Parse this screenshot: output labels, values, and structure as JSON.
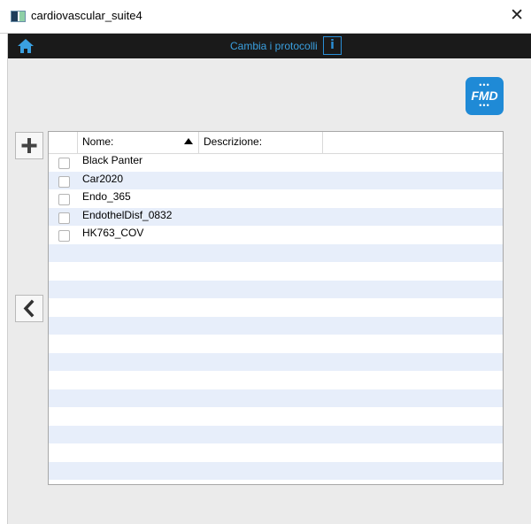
{
  "window": {
    "title": "cardiovascular_suite4",
    "close_glyph": "✕"
  },
  "appbar": {
    "protocols_label": "Cambia i protocolli",
    "info_glyph": "i"
  },
  "logo": {
    "text": "FMD",
    "color": "#1f8ad6"
  },
  "table": {
    "columns": {
      "name": "Nome:",
      "description": "Descrizione:"
    },
    "sort": {
      "column": "name",
      "direction": "ascending"
    },
    "rows": [
      {
        "name": "Black Panter",
        "description": ""
      },
      {
        "name": "Car2020",
        "description": ""
      },
      {
        "name": "Endo_365",
        "description": ""
      },
      {
        "name": "EndothelDisf_0832",
        "description": ""
      },
      {
        "name": "HK763_COV",
        "description": ""
      }
    ]
  },
  "colors": {
    "accent": "#2a8fd6",
    "row_alt": "#e7eefa",
    "appbar_bg": "#1a1a1a"
  },
  "icons": [
    "home-icon",
    "info-icon",
    "plus-icon",
    "chevron-left-icon",
    "close-icon",
    "app-icon"
  ]
}
